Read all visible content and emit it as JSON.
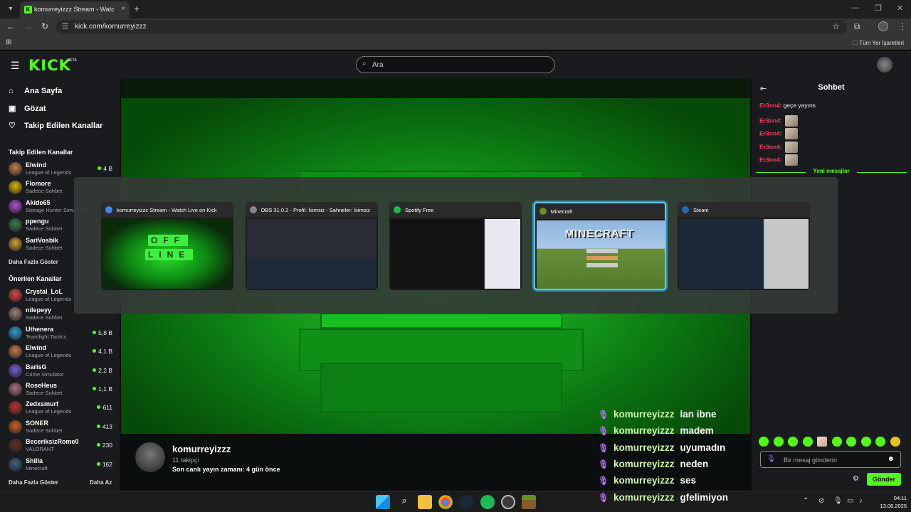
{
  "browser": {
    "tab_title": "komurreyizzz Stream - Watch Live on Kick",
    "tab_close": "×",
    "new_tab": "+",
    "url": "kick.com/komurreyizzz",
    "bookmarks_label": "Tüm Yer İşaretleri"
  },
  "header": {
    "logo": "KICK",
    "beta": "BETA",
    "search_placeholder": "Ara"
  },
  "sidebar": {
    "nav": [
      {
        "label": "Ana Sayfa",
        "icon": "home-icon",
        "glyph": "⌂"
      },
      {
        "label": "Gözat",
        "icon": "browse-icon",
        "glyph": "▣"
      },
      {
        "label": "Takip Edilen Kanallar",
        "icon": "heart-icon",
        "glyph": "♡"
      }
    ],
    "followed_title": "Takip Edilen Kanallar",
    "followed": [
      {
        "name": "Elwind",
        "category": "League of Legends",
        "viewers": "4 B",
        "color": "#c47d4a"
      },
      {
        "name": "Flomore",
        "category": "Sadece Sohbet",
        "viewers": "",
        "color": "#e0b400"
      },
      {
        "name": "Akide65",
        "category": "Storage Hunter Simulator",
        "viewers": "",
        "color": "#b54bd6"
      },
      {
        "name": "ppengu",
        "category": "Sadece Sohbet",
        "viewers": "",
        "color": "#3a7d4a"
      },
      {
        "name": "SariVosbik",
        "category": "Sadece Sohbet",
        "viewers": "",
        "color": "#d8a030"
      }
    ],
    "followed_more": "Daha Fazla Göster",
    "suggested_title": "Önerilen Kanallar",
    "suggested": [
      {
        "name": "Crystal_LoL",
        "category": "League of Legends",
        "viewers": "",
        "color": "#e04646"
      },
      {
        "name": "nilepeyy",
        "category": "Sadece Sohbet",
        "viewers": "",
        "color": "#a08070"
      },
      {
        "name": "Uthenera",
        "category": "Teamfight Tactics",
        "viewers": "5,8 B",
        "color": "#2aa0d8"
      },
      {
        "name": "Elwind",
        "category": "League of Legends",
        "viewers": "4,1 B",
        "color": "#c47d4a"
      },
      {
        "name": "BarisG",
        "category": "Crime Simulator",
        "viewers": "2,2 B",
        "color": "#7a5ad8"
      },
      {
        "name": "RoseHeus",
        "category": "Sadece Sohbet",
        "viewers": "1,1 B",
        "color": "#b07080"
      },
      {
        "name": "Zedxsmurf",
        "category": "League of Legends",
        "viewers": "611",
        "color": "#c03030"
      },
      {
        "name": "SONER",
        "category": "Sadece Sohbet",
        "viewers": "413",
        "color": "#d06020"
      },
      {
        "name": "BeceriksizRome0",
        "category": "VALORANT",
        "viewers": "230",
        "color": "#603020"
      },
      {
        "name": "Shilla",
        "category": "Minecraft",
        "viewers": "162",
        "color": "#406080"
      }
    ],
    "suggested_more": "Daha Fazla Göster",
    "less": "Daha Az"
  },
  "stream_info": {
    "name": "komurreyizzz",
    "followers": "11 takipçi",
    "last_live": "Son canlı yayın zamanı: 4 gün önce"
  },
  "chat": {
    "title": "Sohbet",
    "messages": [
      {
        "user": "Er3nn4",
        "text": "geçe yayıns",
        "emote": false
      },
      {
        "user": "Er3nn4",
        "text": "",
        "emote": true
      },
      {
        "user": "Er3nn4",
        "text": "",
        "emote": true
      },
      {
        "user": "Er3nn4",
        "text": "",
        "emote": true
      },
      {
        "user": "Er3nn4",
        "text": "",
        "emote": true
      }
    ],
    "new_messages": "Yeni mesajlar",
    "input_placeholder": "Bir mesaj gönderin",
    "send": "Gönder"
  },
  "overlay_chat": [
    {
      "user": "komurreyizzz",
      "text": "lan ibne"
    },
    {
      "user": "komurreyizzz",
      "text": "madem"
    },
    {
      "user": "komurreyizzz",
      "text": "uyumadın"
    },
    {
      "user": "komurreyizzz",
      "text": "neden"
    },
    {
      "user": "komurreyizzz",
      "text": "ses"
    },
    {
      "user": "komurreyizzz",
      "text": "gfelimiyon"
    }
  ],
  "switcher": {
    "windows": [
      {
        "title": "komurreyizzz Stream - Watch Live on Kick",
        "icon": "chrome-icon",
        "color": "#4285f4",
        "selected": false
      },
      {
        "title": "OBS 31.0.2 - Profil: İsimsiz - Sahneler: İsimsiz",
        "icon": "obs-icon",
        "color": "#888888",
        "selected": false
      },
      {
        "title": "Spotify Free",
        "icon": "spotify-icon",
        "color": "#1db954",
        "selected": false
      },
      {
        "title": "Minecraft",
        "icon": "minecraft-icon",
        "color": "#6b8e23",
        "selected": true
      },
      {
        "title": "Steam",
        "icon": "steam-icon",
        "color": "#1b6fb0",
        "selected": false
      }
    ],
    "offline_top": "OFF",
    "offline_bottom": "LINE",
    "minecraft_logo": "MINECRAFT"
  },
  "taskbar": {
    "time": "04:11",
    "date": "13.08.2025"
  }
}
